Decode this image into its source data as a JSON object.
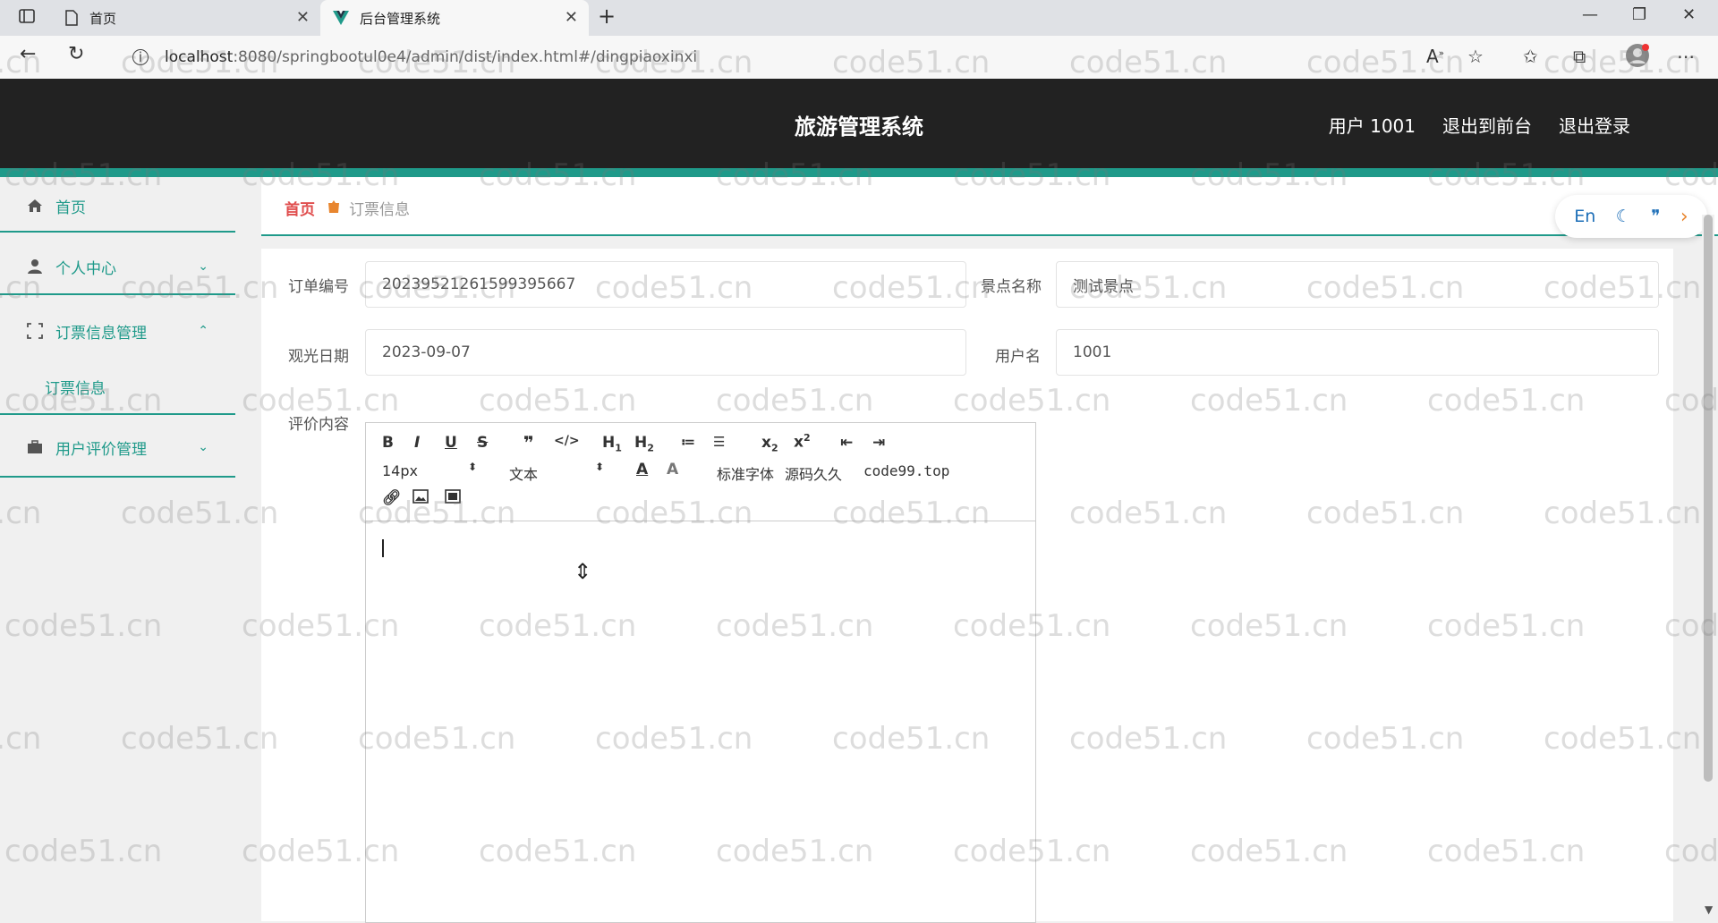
{
  "browser": {
    "tabs": [
      {
        "title": "首页",
        "active": false
      },
      {
        "title": "后台管理系统",
        "active": true
      }
    ],
    "new_tab": "+",
    "url_host": "localhost",
    "url_path": ":8080/springbootul0e4/admin/dist/index.html#/dingpiaoxinxi",
    "window": {
      "minimize": "—",
      "maximize": "❐",
      "close": "✕"
    }
  },
  "header": {
    "title": "旅游管理系统",
    "user": "用户 1001",
    "to_front": "退出到前台",
    "logout": "退出登录"
  },
  "sidebar": {
    "items": [
      {
        "label": "首页",
        "icon": "home-icon"
      },
      {
        "label": "个人中心",
        "icon": "user-icon",
        "chevron": "⌄"
      },
      {
        "label": "订票信息管理",
        "icon": "frame-icon",
        "chevron": "⌃",
        "sub": [
          "订票信息"
        ]
      },
      {
        "label": "用户评价管理",
        "icon": "briefcase-icon",
        "chevron": "⌄"
      }
    ]
  },
  "breadcrumb": {
    "home": "首页",
    "current": "订票信息"
  },
  "float_tools": {
    "lang": "En"
  },
  "form": {
    "order_no_label": "订单编号",
    "order_no_value": "20239521261599395667",
    "scenic_label": "景点名称",
    "scenic_value": "测试景点",
    "date_label": "观光日期",
    "date_value": "2023-09-07",
    "username_label": "用户名",
    "username_value": "1001",
    "review_label": "评价内容"
  },
  "editor": {
    "font_size": "14px",
    "block_type": "文本",
    "font_family": "标准字体",
    "overlay_text": "源码久久",
    "overlay_url": "code99.top"
  },
  "watermark": "code51.cn",
  "colors": {
    "accent": "#1f9a8a",
    "header_bg": "#222222",
    "breadcrumb_home": "#e04e4e"
  }
}
